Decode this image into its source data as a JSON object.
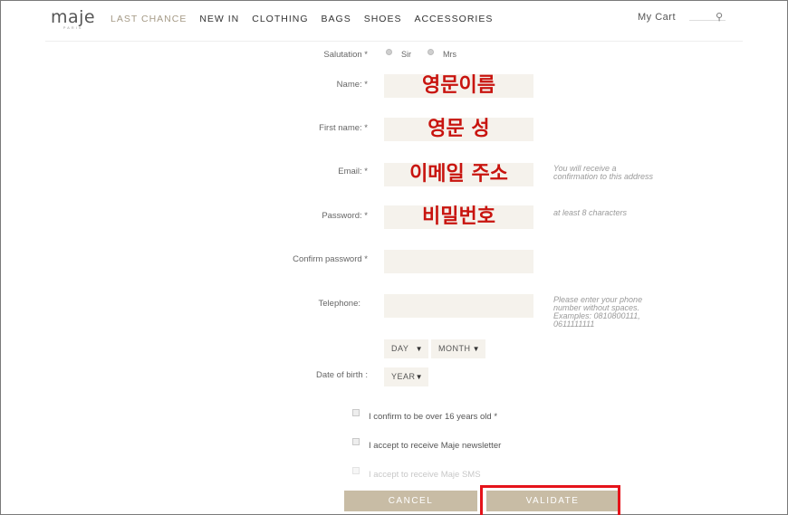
{
  "header": {
    "logo": "maje",
    "logo_sub": "PARIS",
    "nav": [
      {
        "label": "LAST CHANCE",
        "active": true
      },
      {
        "label": "NEW IN",
        "active": false
      },
      {
        "label": "CLOTHING",
        "active": false
      },
      {
        "label": "BAGS",
        "active": false
      },
      {
        "label": "SHOES",
        "active": false
      },
      {
        "label": "ACCESSORIES",
        "active": false
      }
    ],
    "cart_label": "My Cart",
    "search_icon": "search-icon"
  },
  "form": {
    "salutation_label": "Salutation *",
    "salutation_options": [
      "Sir",
      "Mrs"
    ],
    "name_label": "Name: *",
    "name_value": "영문이름",
    "first_name_label": "First name: *",
    "first_name_value": "영문 성",
    "email_label": "Email: *",
    "email_value": "이메일 주소",
    "email_hint": "You will receive a\nconfirmation to this address",
    "password_label": "Password: *",
    "password_value": "비밀번호",
    "password_hint": "at least 8 characters",
    "confirm_password_label": "Confirm password *",
    "confirm_password_value": "",
    "telephone_label": "Telephone:",
    "telephone_value": "",
    "telephone_hint": "Please enter your phone\nnumber without spaces.\nExamples: 0810800111,\n0611111111",
    "dob_label": "Date of birth :",
    "day_select": "DAY",
    "month_select": "MONTH",
    "year_select": "YEAR",
    "checkbox_age": "I confirm to be over 16 years old *",
    "checkbox_newsletter": "I accept to receive Maje newsletter",
    "checkbox_sms": "I accept to receive Maje SMS",
    "cancel_label": "CANCEL",
    "validate_label": "VALIDATE"
  },
  "colors": {
    "accent": "#a59a86",
    "button": "#c8bca5",
    "input_bg": "#f5f2ec",
    "annotation_red": "#c8140f",
    "highlight_border": "#e5131a"
  }
}
